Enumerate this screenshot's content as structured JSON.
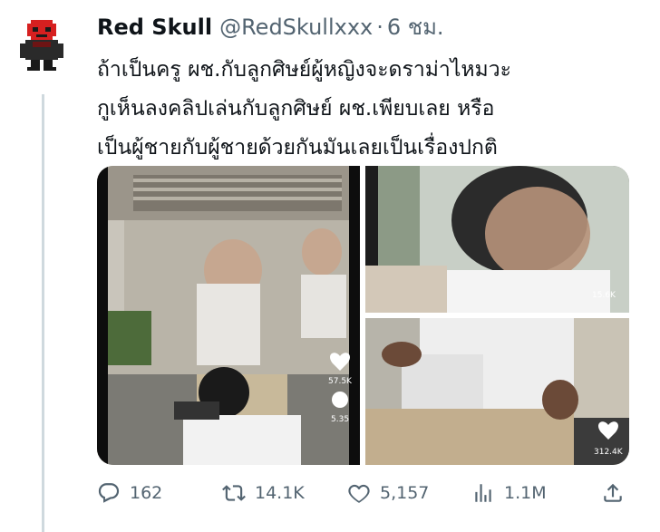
{
  "tweet": {
    "display_name": "Red Skull",
    "handle": "@RedSkullxxx",
    "separator": "·",
    "time": "6 ชม.",
    "text_lines": [
      "ถ้าเป็นครู ผช.กับลูกศิษย์ผู้หญิงจะดราม่าไหมวะ",
      "กูเห็นลงคลิปเล่นกับลูกศิษย์ ผช.เพียบเลย หรือ",
      "เป็นผู้ชายกับผู้ชายด้วยกันมันเลยเป็นเรื่องปกติ"
    ]
  },
  "media": {
    "left_video": {
      "like_count": "57.5K",
      "comment_count": "5.35"
    },
    "top_right_video": {
      "like_count": "15.6K"
    },
    "bottom_right_video": {
      "like_count": "312.4K"
    }
  },
  "actions": {
    "replies": "162",
    "retweets": "14.1K",
    "likes": "5,157",
    "views": "1.1M"
  },
  "icons": {
    "reply": "reply-icon",
    "retweet": "retweet-icon",
    "like": "heart-icon",
    "views": "views-chart-icon",
    "share": "share-icon"
  },
  "colors": {
    "text": "#0f1419",
    "secondary_text": "#536471",
    "thread_line": "#cfd9de"
  }
}
